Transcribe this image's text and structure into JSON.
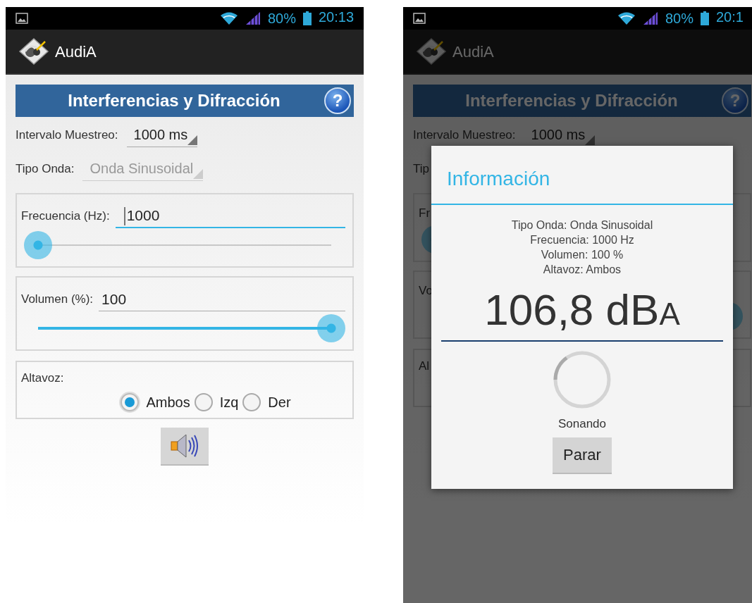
{
  "screens": [
    {
      "status_bar": {
        "battery": "80%",
        "time": "20:13"
      },
      "app_title": "AudiA",
      "header": {
        "title": "Interferencias y Difracción",
        "help": "?"
      },
      "interval": {
        "label": "Intervalo Muestreo:",
        "value": "1000 ms",
        "disabled": false
      },
      "wave": {
        "label": "Tipo Onda:",
        "value": "Onda Sinusoidal",
        "disabled": true
      },
      "frequency": {
        "label": "Frecuencia (Hz):",
        "value": "1000",
        "focused": true,
        "level": 0
      },
      "volume": {
        "label": "Volumen (%):",
        "value": "100",
        "focused": false,
        "level": 1
      },
      "speaker": {
        "label": "Altavoz:",
        "options": [
          {
            "label": "Ambos",
            "selected": true
          },
          {
            "label": "Izq",
            "selected": false
          },
          {
            "label": "Der",
            "selected": false
          }
        ]
      },
      "play_button": true
    },
    {
      "status_bar": {
        "battery": "80%",
        "time": "20:1"
      },
      "app_title": "AudiA",
      "header": {
        "title": "Interferencias y Difracción",
        "help": "?"
      },
      "interval": {
        "label": "Intervalo Muestreo:",
        "value": "1000 ms",
        "disabled": false
      },
      "wave": {
        "label": "Tip"
      },
      "frequency": {
        "label": "Fr",
        "level": 0
      },
      "volume": {
        "label": "Vo",
        "level": 1
      },
      "speaker": {
        "label": "Al"
      },
      "dialog": {
        "title": "Información",
        "lines": [
          "Tipo Onda: Onda Sinusoidal",
          "Frecuencia: 1000 Hz",
          "Volumen: 100 %",
          "Altavoz: Ambos"
        ],
        "reading": "106,8 dB",
        "unit": "A",
        "status": "Sonando",
        "button": "Parar"
      }
    }
  ]
}
